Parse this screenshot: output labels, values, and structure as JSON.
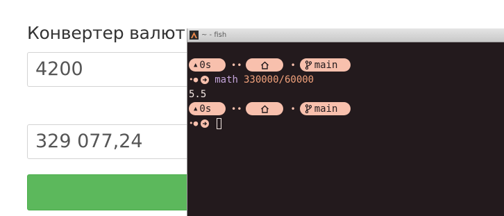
{
  "converter": {
    "title": "Конвертер валют",
    "amount_from": "4200",
    "amount_to": "329 077,24",
    "button_color": "#5cb85c"
  },
  "terminal": {
    "window_title": "~ - fish",
    "prompt1": {
      "duration": "0s",
      "branch": "main"
    },
    "command": {
      "name": "math",
      "args": "330000/60000"
    },
    "output": "5.5",
    "prompt2": {
      "duration": "0s",
      "branch": "main"
    },
    "colors": {
      "background": "#231a1d",
      "segment": "#f8c0ad",
      "command": "#c3a4d9",
      "args": "#f2a27c"
    },
    "icons": [
      "triangle-up-icon",
      "home-icon",
      "git-branch-icon",
      "arrow-right-circle-icon"
    ]
  }
}
